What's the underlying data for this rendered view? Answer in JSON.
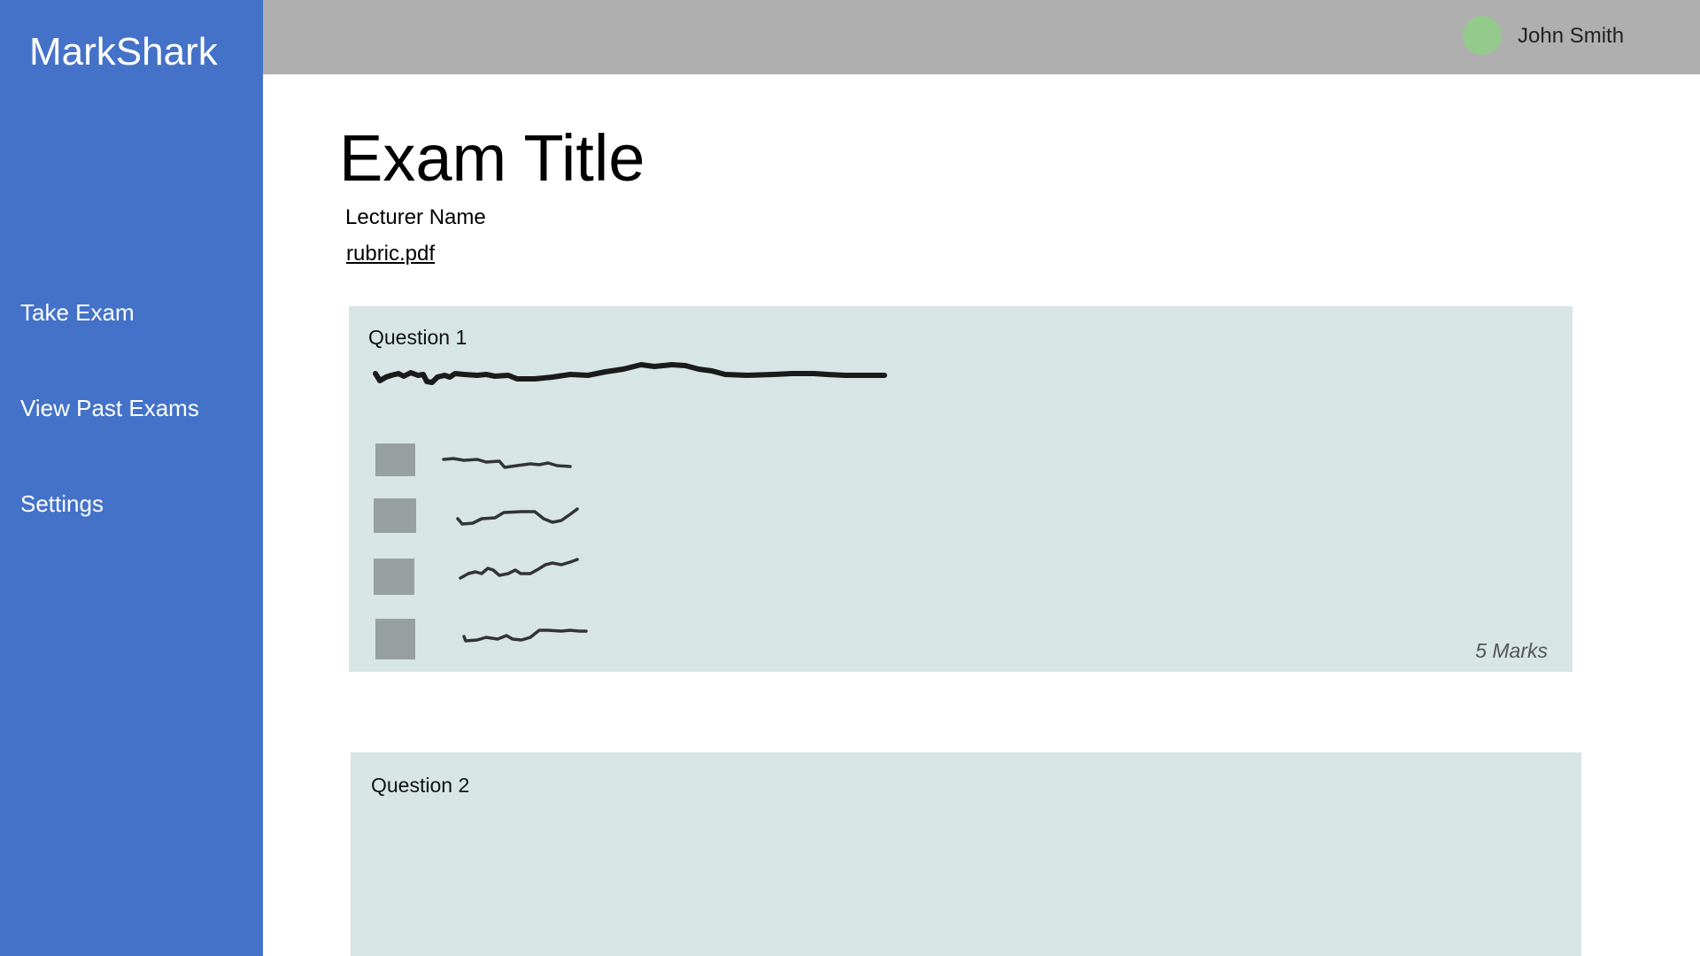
{
  "app": {
    "brand": "MarkShark"
  },
  "sidebar": {
    "items": [
      {
        "label": "Take Exam"
      },
      {
        "label": "View Past Exams"
      },
      {
        "label": "Settings"
      }
    ]
  },
  "header": {
    "user_name": "John Smith"
  },
  "exam": {
    "title": "Exam Title",
    "lecturer": "Lecturer Name",
    "rubric_link": "rubric.pdf"
  },
  "questions": [
    {
      "label": "Question 1",
      "marks": "5 Marks",
      "option_count": 4
    },
    {
      "label": "Question 2"
    }
  ],
  "colors": {
    "sidebar": "#4472c9",
    "topbar": "#afafaf",
    "avatar": "#93c98a",
    "question_card": "#d7e5e4",
    "option_box": "#979f9f"
  }
}
